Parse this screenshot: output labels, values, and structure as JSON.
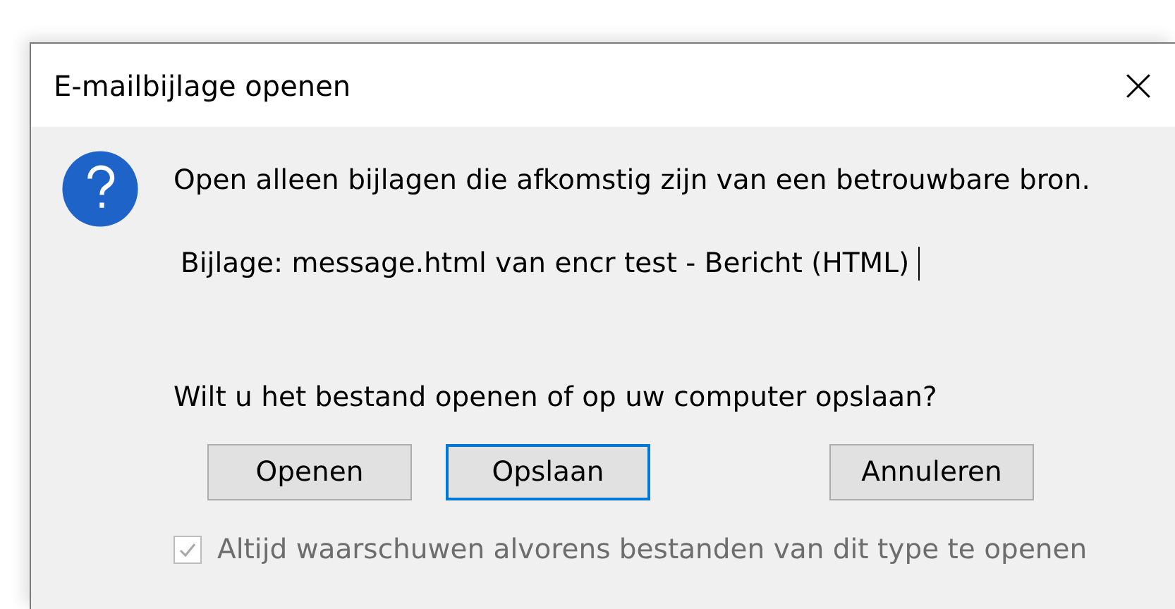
{
  "window": {
    "title": "E-mailbijlage openen"
  },
  "message": "Open alleen bijlagen die afkomstig zijn van een betrouwbare bron.",
  "attachment": {
    "text": "Bijlage: message.html van encr test - Bericht (HTML)",
    "cursor": true
  },
  "question": "Wilt u het bestand openen of op uw computer opslaan?",
  "buttons": [
    {
      "label": "Openen",
      "focused": false
    },
    {
      "label": "Opslaan",
      "focused": true
    },
    {
      "label": "Annuleren",
      "focused": false
    }
  ],
  "checkbox": {
    "label": "Altijd waarschuwen alvorens bestanden van dit type te openen",
    "checked": true,
    "disabled": true
  }
}
